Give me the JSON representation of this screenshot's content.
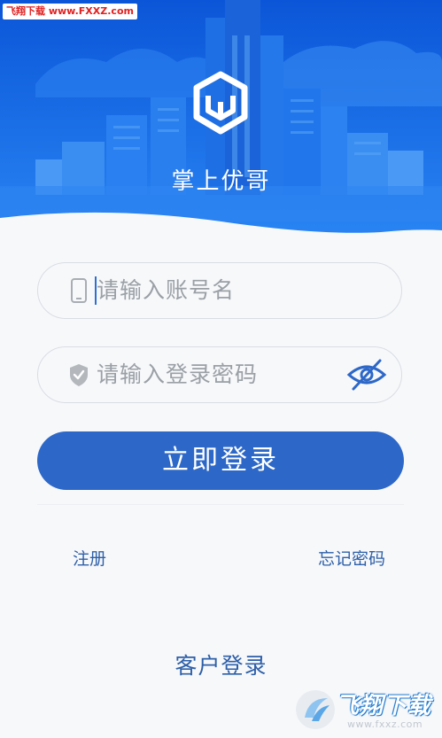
{
  "watermark": {
    "text": "飞翔下载 www.FXXZ.com"
  },
  "app": {
    "title": "掌上优哥"
  },
  "form": {
    "account_placeholder": "请输入账号名",
    "password_placeholder": "请输入登录密码",
    "account_icon": "phone-icon",
    "password_icon": "shield-icon",
    "toggle_icon": "eye-hidden-icon"
  },
  "actions": {
    "login_label": "立即登录",
    "register_label": "注册",
    "forgot_label": "忘记密码",
    "client_login_label": "客户登录"
  },
  "corner_watermark": {
    "brand": "飞翔下载",
    "site": "www.fxxz.com"
  },
  "colors": {
    "accent": "#2d68c8",
    "header_blue": "#1668e8",
    "link": "#2d5fa8",
    "placeholder": "#9aa0a6"
  }
}
